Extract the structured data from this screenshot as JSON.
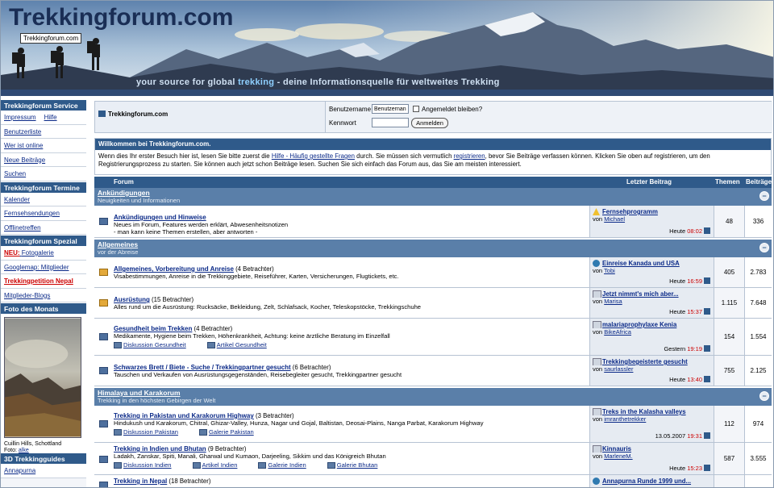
{
  "banner": {
    "title": "Trekkingforum.com",
    "badge": "Trekkingforum.com",
    "tagline_a": "your source for global ",
    "tagline_b": "trekking",
    "tagline_c": " - deine Informationsquelle für weltweites Trekking"
  },
  "sidebar": {
    "service_title": "Trekkingforum Service",
    "impressum": "Impressum",
    "hilfe": "Hilfe",
    "benutzerliste": "Benutzerliste",
    "wer_ist_online": "Wer ist online",
    "neue_beitraege": "Neue Beiträge",
    "suchen": "Suchen",
    "termine_title": "Trekkingforum Termine",
    "kalender": "Kalender",
    "fernsehsendungen": "Fernsehsendungen",
    "offlinetreffen": "Offlinetreffen",
    "spezial_title": "Trekkingforum Spezial",
    "neu_label": "NEU:",
    "fotogalerie": "Fotogalerie",
    "googlemap": "Googlemap: Mitglieder",
    "petition": "Trekkingpetition Nepal",
    "mitglieder_blogs": "Mitglieder-Blogs",
    "foto_title": "Foto des Monats",
    "photo_caption": "Cuillin Hills, Schottland",
    "photo_by_label": "Foto: ",
    "photo_by": "alke",
    "guides_title": "3D Trekkingguides",
    "annapurna": "Annapurna"
  },
  "login": {
    "site": "Trekkingforum.com",
    "user_label": "Benutzername",
    "user_value": "Benutzernan",
    "remember": "Angemeldet bleiben?",
    "pass_label": "Kennwort",
    "button": "Anmelden"
  },
  "welcome": {
    "title": "Willkommen bei Trekkingforum.com.",
    "t1": "Wenn dies Ihr erster Besuch hier ist, lesen Sie bitte zuerst die ",
    "link1": "Hilfe - Häufig gestellte Fragen",
    "t2": " durch. Sie müssen sich vermutlich ",
    "link2": "registrieren",
    "t3": ", bevor Sie Beiträge verfassen können. Klicken Sie oben auf registrieren, um den Registrierungsprozess zu starten. Sie können auch jetzt schon Beiträge lesen. Suchen Sie sich einfach das Forum aus, das Sie am meisten interessiert."
  },
  "table": {
    "col_forum": "Forum",
    "col_last": "Letzter Beitrag",
    "col_themen": "Themen",
    "col_beitraege": "Beiträge"
  },
  "cats": [
    {
      "title": "Ankündigungen",
      "desc": "Neuigkeiten und Informationen"
    },
    {
      "title": "Allgemeines",
      "desc": "vor der Abreise"
    },
    {
      "title": "Himalaya und Karakorum",
      "desc": "Trekking in den höchsten Gebirgen der Welt"
    }
  ],
  "forums": [
    {
      "title": "Ankündigungen und Hinweise",
      "viewers": "",
      "desc": "Neues im Forum, Features werden erklärt, Abwesenheitsnotizen",
      "desc2": "- man kann keine Themen erstellen, aber antworten -",
      "last_title": "Fernsehprogramm",
      "last_by": "Michael",
      "last_date": "Heute ",
      "last_time": "08:02",
      "themen": "48",
      "beitraege": "336"
    },
    {
      "title": "Allgemeines, Vorbereitung und Anreise",
      "viewers": " (4 Betrachter)",
      "desc": "Visabestimmungen, Anreise in die Trekkinggebiete, Reiseführer, Karten, Versicherungen, Flugtickets, etc.",
      "last_title": "Einreise Kanada und USA",
      "last_by": "Tobi",
      "last_date": "Heute ",
      "last_time": "16:59",
      "themen": "405",
      "beitraege": "2.783"
    },
    {
      "title": "Ausrüstung",
      "viewers": " (15 Betrachter)",
      "desc": "Alles rund um die Ausrüstung: Rucksäcke, Bekleidung, Zelt, Schlafsack, Kocher, Teleskopstöcke, Trekkingschuhe",
      "last_title": "Jetzt nimmt's mich aber...",
      "last_by": "Marisa",
      "last_date": "Heute ",
      "last_time": "15:37",
      "themen": "1.115",
      "beitraege": "7.648"
    },
    {
      "title": "Gesundheit beim Trekken",
      "viewers": " (4 Betrachter)",
      "desc": "Medikamente, Hygiene beim Trekken, Höhenkrankheit, Achtung: keine ärztliche Beratung im Einzelfall",
      "sub1": "Diskussion Gesundheit",
      "sub2": "Artikel Gesundheit",
      "last_title": "malariaprophylaxe Kenia",
      "last_by": "BikeAfrica",
      "last_date": "Gestern ",
      "last_time": "19:19",
      "themen": "154",
      "beitraege": "1.554"
    },
    {
      "title": "Schwarzes Brett / Biete - Suche / Trekkingpartner gesucht",
      "viewers": " (6 Betrachter)",
      "desc": "Tauschen und Verkaufen von Ausrüstungsgegenständen, Reisebegleiter gesucht, Trekkingpartner gesucht",
      "last_title": "Trekkingbegeisterte gesucht",
      "last_by": "saurlassler",
      "last_date": "Heute ",
      "last_time": "13:40",
      "themen": "755",
      "beitraege": "2.125"
    },
    {
      "title": "Trekking in Pakistan und Karakorum Highway",
      "viewers": " (3 Betrachter)",
      "desc": "Hindukush und Karakorum, Chitral, Ghizar-Valley, Hunza, Nagar und Gojal, Baltistan, Deosai-Plains, Nanga Parbat, Karakorum Highway",
      "sub1": "Diskussion Pakistan",
      "sub2": "Galerie Pakistan",
      "last_title": "Treks in the Kalasha valleys",
      "last_by": "imranthetrekker",
      "last_date": "13.05.2007 ",
      "last_time": "19:31",
      "themen": "112",
      "beitraege": "974"
    },
    {
      "title": "Trekking in Indien und Bhutan",
      "viewers": " (9 Betrachter)",
      "desc": "Ladakh, Zanskar, Spiti, Manali, Gharwal und Kumaon, Darjeeling, Sikkim und das Königreich Bhutan",
      "sub1": "Diskussion Indien",
      "sub2": "Artikel Indien",
      "sub3": "Galerie Indien",
      "sub4": "Galerie Bhutan",
      "last_title": "Kinnauris",
      "last_by": "MarleneM.",
      "last_date": "Heute ",
      "last_time": "15:23",
      "themen": "587",
      "beitraege": "3.555"
    },
    {
      "title": "Trekking in Nepal",
      "viewers": " (18 Betrachter)",
      "last_title": "Annapurna Runde 1999 und..."
    }
  ],
  "by_label": "von ",
  "colors": {
    "header": "#2f5a8a",
    "category": "#5a7fa9",
    "link": "#0b2a88",
    "accent": "#c00000"
  }
}
